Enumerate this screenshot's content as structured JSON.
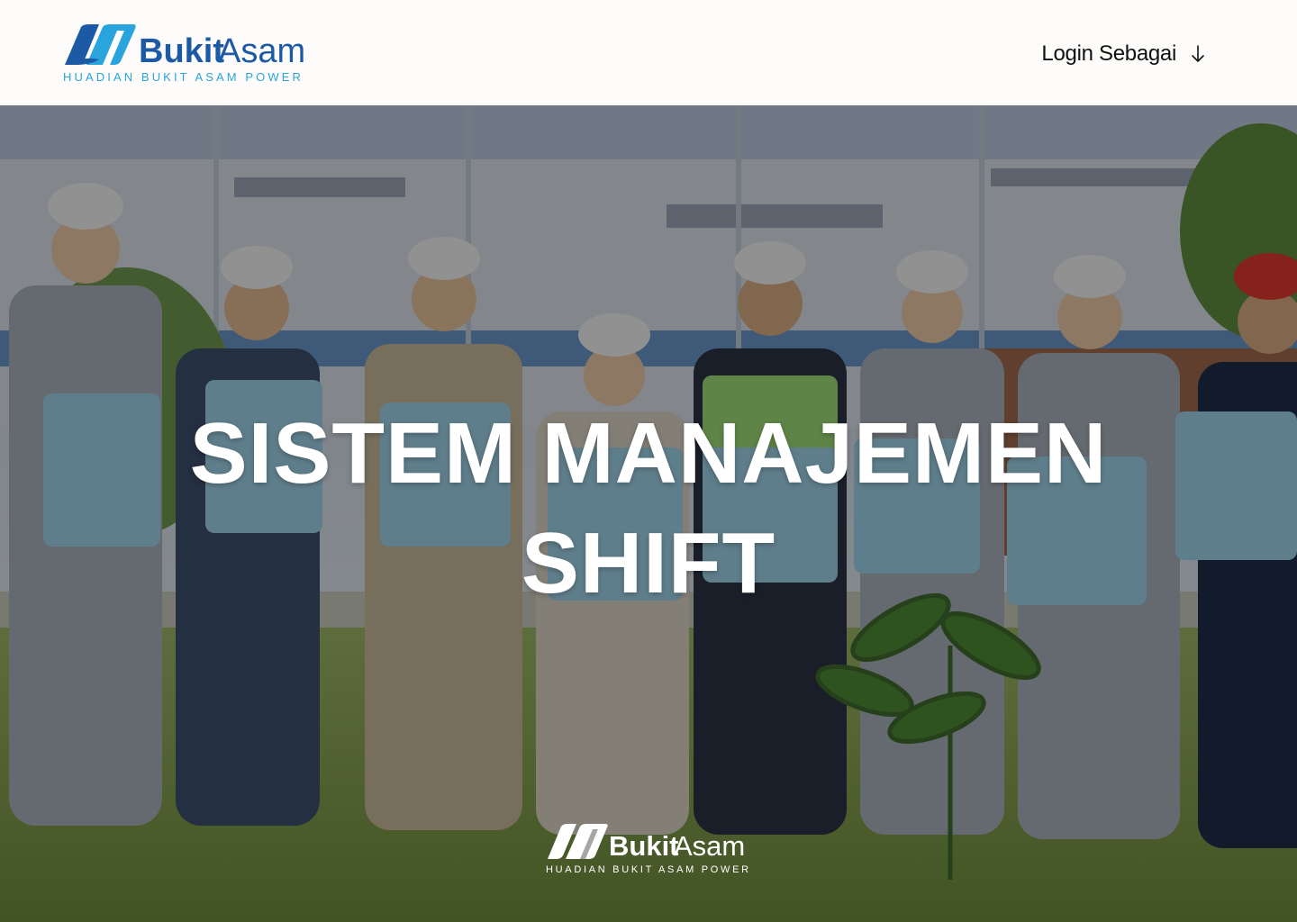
{
  "brand": {
    "name_bold": "Bukit",
    "name_light": "Asam",
    "tagline": "HUADIAN BUKIT ASAM POWER",
    "primary_color": "#1d5aa6",
    "accent_color": "#2aa4dc"
  },
  "header": {
    "login_menu_label": "Login Sebagai",
    "login_menu_icon": "arrow-down-icon"
  },
  "hero": {
    "title_line1": "SISTEM MANAJEMEN",
    "title_line2": "SHIFT",
    "background": "photo of workers in hard hats holding World Environment Day bags"
  },
  "footer_logo": {
    "name_bold": "Bukit",
    "name_light": "Asam",
    "tagline": "HUADIAN BUKIT ASAM POWER"
  }
}
